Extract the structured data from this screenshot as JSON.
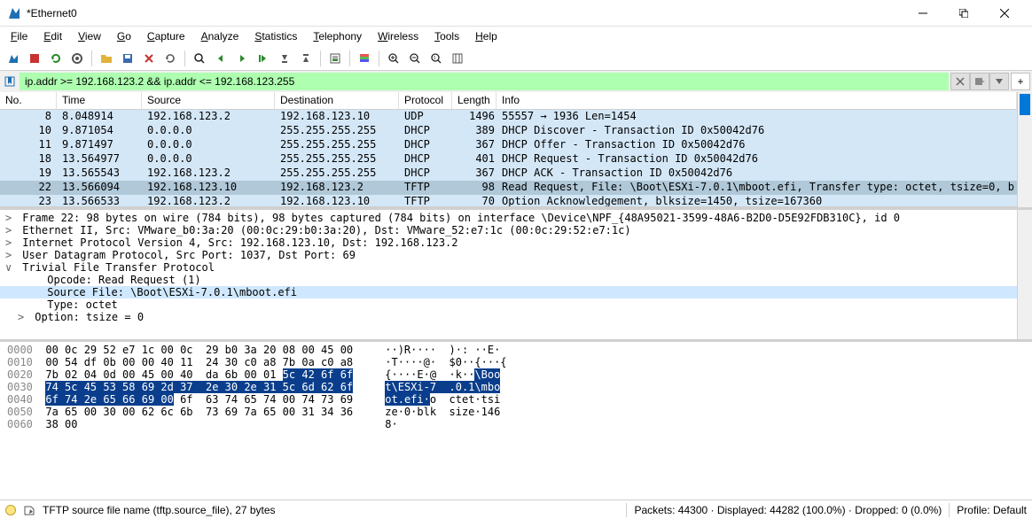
{
  "window": {
    "title": "*Ethernet0"
  },
  "menu": {
    "items": [
      "File",
      "Edit",
      "View",
      "Go",
      "Capture",
      "Analyze",
      "Statistics",
      "Telephony",
      "Wireless",
      "Tools",
      "Help"
    ]
  },
  "filter": {
    "value": "ip.addr >= 192.168.123.2 && ip.addr <= 192.168.123.255"
  },
  "columns": [
    "No.",
    "Time",
    "Source",
    "Destination",
    "Protocol",
    "Length",
    "Info"
  ],
  "packets": [
    {
      "no": "8",
      "time": "8.048914",
      "src": "192.168.123.2",
      "dst": "192.168.123.10",
      "proto": "UDP",
      "len": "1496",
      "info": "55557 → 1936 Len=1454",
      "cls": "udp"
    },
    {
      "no": "10",
      "time": "9.871054",
      "src": "0.0.0.0",
      "dst": "255.255.255.255",
      "proto": "DHCP",
      "len": "389",
      "info": "DHCP Discover - Transaction ID 0x50042d76",
      "cls": "dhcp"
    },
    {
      "no": "11",
      "time": "9.871497",
      "src": "0.0.0.0",
      "dst": "255.255.255.255",
      "proto": "DHCP",
      "len": "367",
      "info": "DHCP Offer    - Transaction ID 0x50042d76",
      "cls": "dhcp"
    },
    {
      "no": "18",
      "time": "13.564977",
      "src": "0.0.0.0",
      "dst": "255.255.255.255",
      "proto": "DHCP",
      "len": "401",
      "info": "DHCP Request  - Transaction ID 0x50042d76",
      "cls": "dhcp"
    },
    {
      "no": "19",
      "time": "13.565543",
      "src": "192.168.123.2",
      "dst": "255.255.255.255",
      "proto": "DHCP",
      "len": "367",
      "info": "DHCP ACK      - Transaction ID 0x50042d76",
      "cls": "dhcp"
    },
    {
      "no": "22",
      "time": "13.566094",
      "src": "192.168.123.10",
      "dst": "192.168.123.2",
      "proto": "TFTP",
      "len": "98",
      "info": "Read Request, File: \\Boot\\ESXi-7.0.1\\mboot.efi, Transfer type: octet, tsize=0, b",
      "cls": "tftp",
      "sel": true
    },
    {
      "no": "23",
      "time": "13.566533",
      "src": "192.168.123.2",
      "dst": "192.168.123.10",
      "proto": "TFTP",
      "len": "70",
      "info": "Option Acknowledgement, blksize=1450, tsize=167360",
      "cls": "tftp",
      "cut": true
    }
  ],
  "tree": [
    {
      "exp": ">",
      "indent": 0,
      "text": "Frame 22: 98 bytes on wire (784 bits), 98 bytes captured (784 bits) on interface \\Device\\NPF_{48A95021-3599-48A6-B2D0-D5E92FDB310C}, id 0"
    },
    {
      "exp": ">",
      "indent": 0,
      "text": "Ethernet II, Src: VMware_b0:3a:20 (00:0c:29:b0:3a:20), Dst: VMware_52:e7:1c (00:0c:29:52:e7:1c)"
    },
    {
      "exp": ">",
      "indent": 0,
      "text": "Internet Protocol Version 4, Src: 192.168.123.10, Dst: 192.168.123.2"
    },
    {
      "exp": ">",
      "indent": 0,
      "text": "User Datagram Protocol, Src Port: 1037, Dst Port: 69"
    },
    {
      "exp": "v",
      "indent": 0,
      "text": "Trivial File Transfer Protocol"
    },
    {
      "exp": "",
      "indent": 2,
      "text": "Opcode: Read Request (1)"
    },
    {
      "exp": "",
      "indent": 2,
      "text": "Source File: \\Boot\\ESXi-7.0.1\\mboot.efi",
      "sel": true
    },
    {
      "exp": "",
      "indent": 2,
      "text": "Type: octet"
    },
    {
      "exp": ">",
      "indent": 1,
      "text": "Option: tsize = 0"
    }
  ],
  "hex": {
    "offsets": [
      "0000",
      "0010",
      "0020",
      "0030",
      "0040",
      "0050",
      "0060"
    ],
    "bytes_plain": [
      "00 0c 29 52 e7 1c 00 0c  29 b0 3a 20 08 00 45 00",
      "00 54 df 0b 00 00 40 11  24 30 c0 a8 7b 0a c0 a8",
      "7b 02 04 0d 00 45 00 40  da 6b 00 01 ",
      "",
      "",
      "7a 65 00 30 00 62 6c 6b  73 69 7a 65 00 31 34 36",
      "38 00"
    ],
    "bytes_hl": [
      "",
      "",
      "5c 42 6f 6f",
      "74 5c 45 53 58 69 2d 37  2e 30 2e 31 5c 6d 62 6f",
      "6f 74 2e 65 66 69 00",
      "",
      ""
    ],
    "bytes_trail": [
      "",
      "",
      "",
      "",
      " 6f  63 74 65 74 00 74 73 69",
      "",
      ""
    ],
    "ascii_pre": [
      "··)R····  )·: ··E·",
      "·T····@·  $0··{···{",
      "{····E·@  ·k··",
      "",
      "",
      "ze·0·blk  size·146",
      "8·"
    ],
    "ascii_hl": [
      "",
      "",
      "\\Boo",
      "t\\ESXi-7  .0.1\\mbo",
      "ot.efi·",
      "",
      ""
    ],
    "ascii_post": [
      "",
      "",
      "",
      "",
      "o  ctet·tsi",
      "",
      ""
    ]
  },
  "status": {
    "left": "TFTP source file name (tftp.source_file), 27 bytes",
    "packets": "Packets: 44300 · Displayed: 44282 (100.0%) · Dropped: 0 (0.0%)",
    "profile": "Profile: Default"
  }
}
